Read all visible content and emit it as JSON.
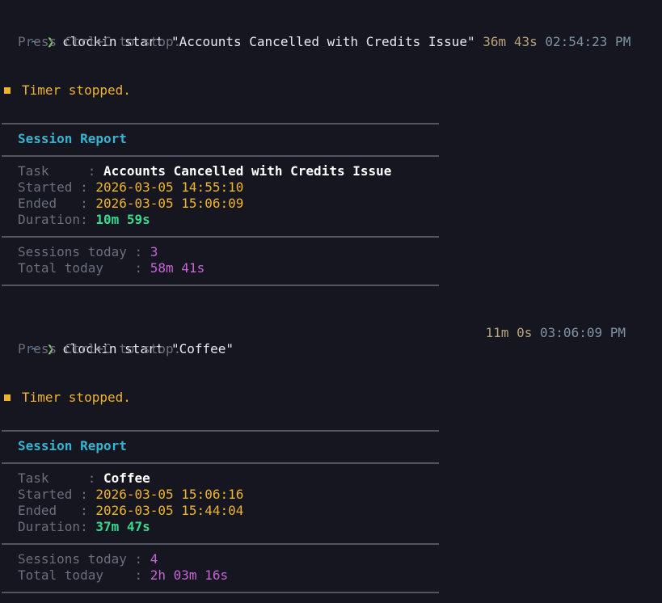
{
  "theme": {
    "background": "#161620",
    "accent_cyan": "#37b4cf",
    "accent_yellow": "#f0b429",
    "accent_green": "#39d98a",
    "accent_magenta": "#c864d6"
  },
  "prompt_symbols": {
    "tilde": "~",
    "chevron": "❯"
  },
  "blocks": [
    {
      "command": "clockin start \"Accounts Cancelled with Credits Issue\"",
      "elapsed": "36m 43s",
      "clock": "02:54:23 PM",
      "hint": "Press Ctrl+C to stop.",
      "stopped_text": "Timer stopped.",
      "report": {
        "title": "Session Report",
        "task_label": "Task     : ",
        "task": "Accounts Cancelled with Credits Issue",
        "started_label": "Started : ",
        "started": "2026-03-05 14:55:10",
        "ended_label": "Ended   : ",
        "ended": "2026-03-05 15:06:09",
        "duration_label": "Duration: ",
        "duration": "10m 59s",
        "sessions_label": "Sessions today : ",
        "sessions": "3",
        "total_label": "Total today    : ",
        "total": "58m 41s"
      }
    },
    {
      "command": "clockin start \"Coffee\"",
      "elapsed": "11m 0s",
      "clock": "03:06:09 PM",
      "hint": "Press Ctrl+C to stop.",
      "stopped_text": "Timer stopped.",
      "report": {
        "title": "Session Report",
        "task_label": "Task     : ",
        "task": "Coffee",
        "started_label": "Started : ",
        "started": "2026-03-05 15:06:16",
        "ended_label": "Ended   : ",
        "ended": "2026-03-05 15:44:04",
        "duration_label": "Duration: ",
        "duration": "37m 47s",
        "sessions_label": "Sessions today : ",
        "sessions": "4",
        "total_label": "Total today    : ",
        "total": "2h 03m 16s"
      }
    }
  ]
}
